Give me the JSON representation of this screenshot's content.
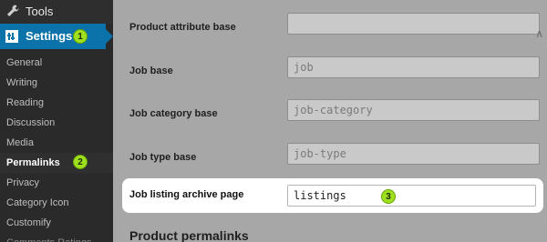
{
  "sidebar": {
    "tools_label": "Tools",
    "settings_label": "Settings",
    "items": [
      {
        "label": "General"
      },
      {
        "label": "Writing"
      },
      {
        "label": "Reading"
      },
      {
        "label": "Discussion"
      },
      {
        "label": "Media"
      },
      {
        "label": "Permalinks",
        "active": true
      },
      {
        "label": "Privacy"
      },
      {
        "label": "Category Icon"
      },
      {
        "label": "Customify"
      },
      {
        "label": "Comments Ratings"
      }
    ]
  },
  "badges": {
    "one": "1",
    "two": "2",
    "three": "3"
  },
  "fields": [
    {
      "label": "Product attribute base",
      "value": ""
    },
    {
      "label": "Job base",
      "placeholder": "job"
    },
    {
      "label": "Job category base",
      "placeholder": "job-category"
    },
    {
      "label": "Job type base",
      "placeholder": "job-type"
    },
    {
      "label": "Job listing archive page",
      "value": "listings"
    }
  ],
  "section_title": "Product permalinks",
  "colors": {
    "accent": "#0b73aa",
    "badge": "#9ee01e"
  }
}
